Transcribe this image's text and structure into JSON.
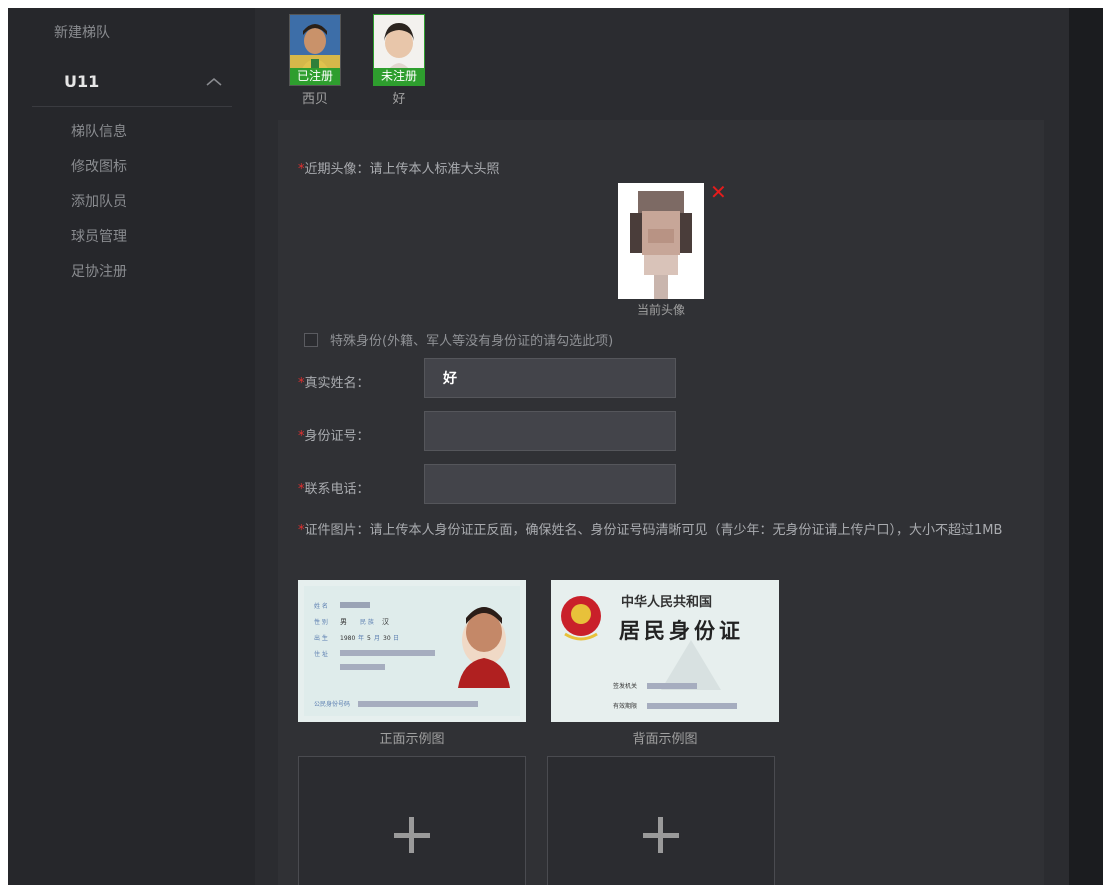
{
  "sidebar": {
    "new_team": "新建梯队",
    "team_name": "U11",
    "menu": [
      "梯队信息",
      "修改图标",
      "添加队员",
      "球员管理",
      "足协注册"
    ]
  },
  "players": [
    {
      "name": "西贝",
      "status": "已注册",
      "badge_color": "#2e9e2e"
    },
    {
      "name": "好",
      "status": "未注册",
      "badge_color": "#2e9e2e"
    }
  ],
  "form": {
    "avatar_label": "近期头像：请上传本人标准大头照",
    "avatar_caption": "当前头像",
    "special_identity": "特殊身份(外籍、军人等没有身份证的请勾选此项)",
    "name_label": "真实姓名：",
    "name_value": "好",
    "id_label": "身份证号：",
    "id_value": "",
    "phone_label": "联系电话：",
    "phone_value": "",
    "cert_note": "证件图片：请上传本人身份证正反面，确保姓名、身份证号码清晰可见（青少年：无身份证请上传户口），大小不超过1MB",
    "front_caption": "正面示例图",
    "back_caption": "背面示例图",
    "required_mark": "*"
  },
  "id_card_front": {
    "name_label": "姓 名",
    "gender_label": "性 别",
    "gender": "男",
    "ethnicity_label": "民 族",
    "ethnicity": "汉",
    "birth_label": "出 生",
    "birth_year": "1980",
    "year_unit": "年",
    "birth_month": "5",
    "month_unit": "月",
    "birth_day": "30",
    "day_unit": "日",
    "address_label": "住 址",
    "id_number_label": "公民身份号码"
  },
  "id_card_back": {
    "country": "中华人民共和国",
    "title": "居民身份证",
    "issuer_label": "签发机关",
    "validity_label": "有效期限"
  },
  "colors": {
    "accent_red": "#e51c1c",
    "registered_green": "#2e9e2e"
  }
}
